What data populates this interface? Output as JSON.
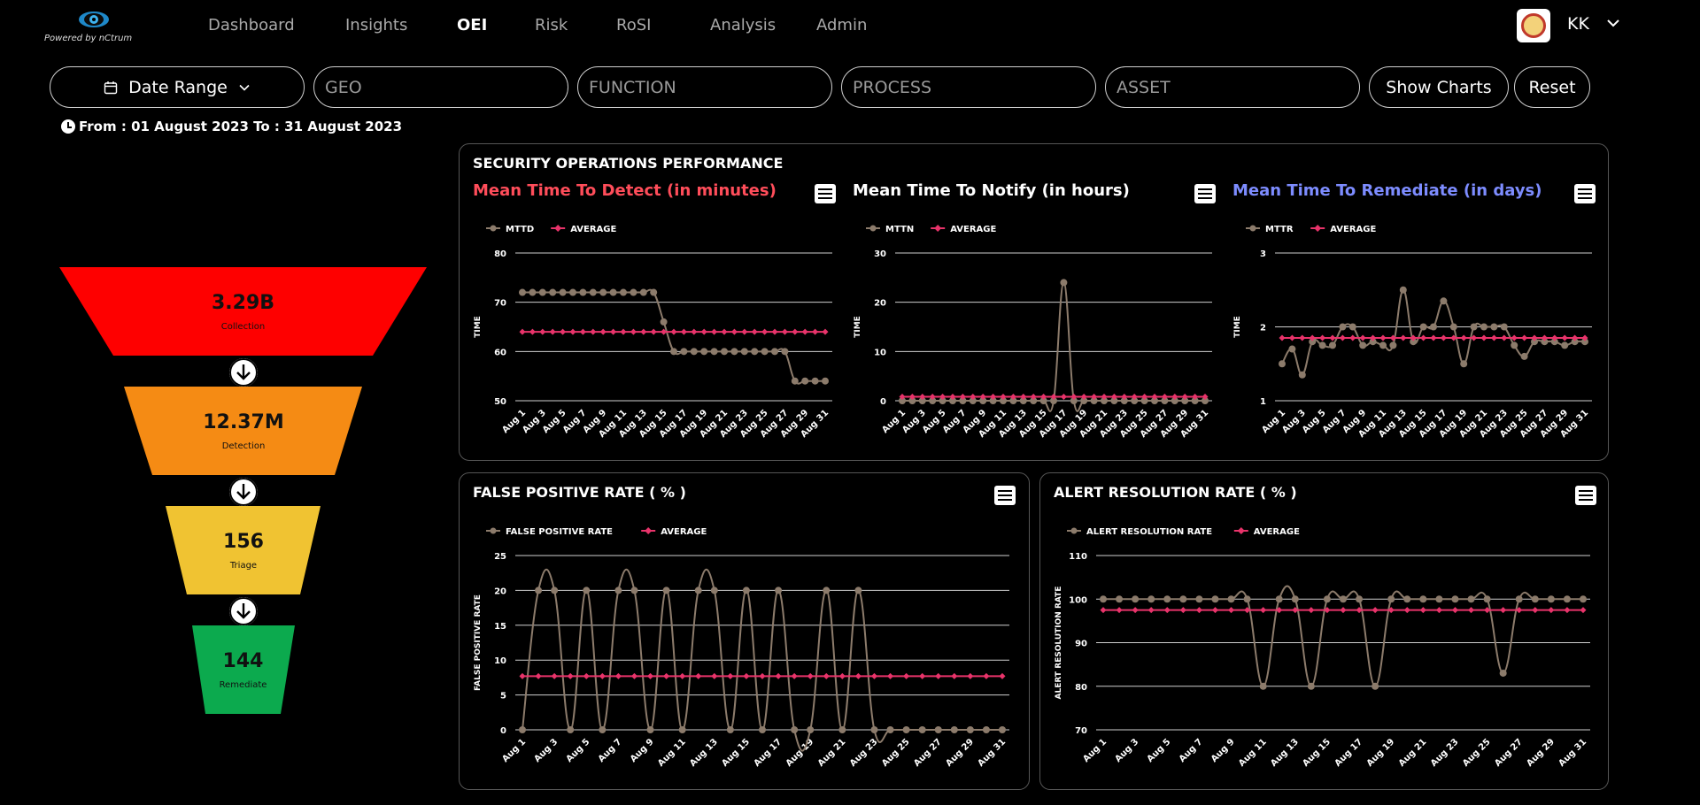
{
  "brand": {
    "powered_by": "Powered by nCtrum"
  },
  "nav": [
    "Dashboard",
    "Insights",
    "OEI",
    "Risk",
    "RoSI",
    "Analysis",
    "Admin"
  ],
  "nav_active": "OEI",
  "user": {
    "initials": "KK"
  },
  "filters": {
    "date_range": "Date Range",
    "geo": "GEO",
    "function": "FUNCTION",
    "process": "PROCESS",
    "asset": "ASSET",
    "show_charts": "Show Charts",
    "reset": "Reset"
  },
  "date_note": "From : 01 August 2023 To : 31 August 2023",
  "funnel": [
    {
      "value": "3.29B",
      "label": "Collection",
      "color": "#fe0000"
    },
    {
      "value": "12.37M",
      "label": "Detection",
      "color": "#f58b14"
    },
    {
      "value": "156",
      "label": "Triage",
      "color": "#f0c332"
    },
    {
      "value": "144",
      "label": "Remediate",
      "color": "#0caa4e"
    }
  ],
  "panels": {
    "sop_title": "SECURITY OPERATIONS PERFORMANCE",
    "fpr_title": "FALSE POSITIVE RATE ( % )",
    "arr_title": "ALERT RESOLUTION RATE ( % )"
  },
  "colors": {
    "series": "#8c7b6b",
    "average": "#e8336a",
    "mttd_title": "#ff4d5a",
    "mttr_title": "#7d8cff"
  },
  "chart_data": [
    {
      "id": "mttd",
      "type": "line",
      "title": "Mean Time To Detect (in minutes)",
      "ylabel": "TIME",
      "ylim": [
        50,
        80
      ],
      "yticks": [
        50,
        60,
        70,
        80
      ],
      "x": [
        "Aug 1",
        "Aug 2",
        "Aug 3",
        "Aug 4",
        "Aug 5",
        "Aug 6",
        "Aug 7",
        "Aug 8",
        "Aug 9",
        "Aug 10",
        "Aug 11",
        "Aug 12",
        "Aug 13",
        "Aug 14",
        "Aug 15",
        "Aug 16",
        "Aug 17",
        "Aug 18",
        "Aug 19",
        "Aug 20",
        "Aug 21",
        "Aug 22",
        "Aug 23",
        "Aug 24",
        "Aug 25",
        "Aug 26",
        "Aug 27",
        "Aug 28",
        "Aug 29",
        "Aug 30",
        "Aug 31"
      ],
      "series": [
        {
          "name": "MTTD",
          "values": [
            72,
            72,
            72,
            72,
            72,
            72,
            72,
            72,
            72,
            72,
            72,
            72,
            72,
            72,
            66,
            60,
            60,
            60,
            60,
            60,
            60,
            60,
            60,
            60,
            60,
            60,
            60,
            54,
            54,
            54,
            54
          ]
        },
        {
          "name": "AVERAGE",
          "values": [
            64,
            64,
            64,
            64,
            64,
            64,
            64,
            64,
            64,
            64,
            64,
            64,
            64,
            64,
            64,
            64,
            64,
            64,
            64,
            64,
            64,
            64,
            64,
            64,
            64,
            64,
            64,
            64,
            64,
            64,
            64
          ]
        }
      ]
    },
    {
      "id": "mttn",
      "type": "line",
      "title": "Mean Time To Notify (in hours)",
      "ylabel": "TIME",
      "ylim": [
        0,
        30
      ],
      "yticks": [
        0,
        10,
        20,
        30
      ],
      "x": [
        "Aug 1",
        "Aug 2",
        "Aug 3",
        "Aug 4",
        "Aug 5",
        "Aug 6",
        "Aug 7",
        "Aug 8",
        "Aug 9",
        "Aug 10",
        "Aug 11",
        "Aug 12",
        "Aug 13",
        "Aug 14",
        "Aug 15",
        "Aug 16",
        "Aug 17",
        "Aug 18",
        "Aug 19",
        "Aug 20",
        "Aug 21",
        "Aug 22",
        "Aug 23",
        "Aug 24",
        "Aug 25",
        "Aug 26",
        "Aug 27",
        "Aug 28",
        "Aug 29",
        "Aug 30",
        "Aug 31"
      ],
      "series": [
        {
          "name": "MTTN",
          "values": [
            0,
            0,
            0,
            0,
            0,
            0,
            0,
            0,
            0,
            0,
            0,
            0,
            0,
            0,
            0,
            0,
            24,
            0,
            0,
            0,
            0,
            0,
            0,
            0,
            0,
            0,
            0,
            0,
            0,
            0,
            0
          ]
        },
        {
          "name": "AVERAGE",
          "values": [
            0.8,
            0.8,
            0.8,
            0.8,
            0.8,
            0.8,
            0.8,
            0.8,
            0.8,
            0.8,
            0.8,
            0.8,
            0.8,
            0.8,
            0.8,
            0.8,
            0.8,
            0.8,
            0.8,
            0.8,
            0.8,
            0.8,
            0.8,
            0.8,
            0.8,
            0.8,
            0.8,
            0.8,
            0.8,
            0.8,
            0.8
          ]
        }
      ]
    },
    {
      "id": "mttr",
      "type": "line",
      "title": "Mean Time To Remediate (in days)",
      "ylabel": "TIME",
      "ylim": [
        1,
        3
      ],
      "yticks": [
        1,
        2,
        3
      ],
      "x": [
        "Aug 1",
        "Aug 2",
        "Aug 3",
        "Aug 4",
        "Aug 5",
        "Aug 6",
        "Aug 7",
        "Aug 8",
        "Aug 9",
        "Aug 10",
        "Aug 11",
        "Aug 12",
        "Aug 13",
        "Aug 14",
        "Aug 15",
        "Aug 16",
        "Aug 17",
        "Aug 18",
        "Aug 19",
        "Aug 20",
        "Aug 21",
        "Aug 22",
        "Aug 23",
        "Aug 24",
        "Aug 25",
        "Aug 26",
        "Aug 27",
        "Aug 28",
        "Aug 29",
        "Aug 30",
        "Aug 31"
      ],
      "series": [
        {
          "name": "MTTR",
          "values": [
            1.5,
            1.7,
            1.35,
            1.8,
            1.75,
            1.75,
            2.0,
            2.0,
            1.75,
            1.8,
            1.75,
            1.75,
            2.5,
            1.8,
            2.0,
            2.0,
            2.35,
            2.0,
            1.5,
            2.0,
            2.0,
            2.0,
            2.0,
            1.75,
            1.6,
            1.8,
            1.8,
            1.8,
            1.75,
            1.8,
            1.8
          ]
        },
        {
          "name": "AVERAGE",
          "values": [
            1.85,
            1.85,
            1.85,
            1.85,
            1.85,
            1.85,
            1.85,
            1.85,
            1.85,
            1.85,
            1.85,
            1.85,
            1.85,
            1.85,
            1.85,
            1.85,
            1.85,
            1.85,
            1.85,
            1.85,
            1.85,
            1.85,
            1.85,
            1.85,
            1.85,
            1.85,
            1.85,
            1.85,
            1.85,
            1.85,
            1.85
          ]
        }
      ]
    },
    {
      "id": "fpr",
      "type": "line",
      "ylabel": "FALSE POSITIVE RATE",
      "ylim": [
        0,
        25
      ],
      "yticks": [
        0,
        5,
        10,
        15,
        20,
        25
      ],
      "x": [
        "Aug 1",
        "Aug 2",
        "Aug 3",
        "Aug 4",
        "Aug 5",
        "Aug 6",
        "Aug 7",
        "Aug 8",
        "Aug 9",
        "Aug 10",
        "Aug 11",
        "Aug 12",
        "Aug 13",
        "Aug 14",
        "Aug 15",
        "Aug 16",
        "Aug 17",
        "Aug 18",
        "Aug 19",
        "Aug 20",
        "Aug 21",
        "Aug 22",
        "Aug 23",
        "Aug 24",
        "Aug 25",
        "Aug 26",
        "Aug 27",
        "Aug 28",
        "Aug 29",
        "Aug 30",
        "Aug 31"
      ],
      "series": [
        {
          "name": "FALSE POSITIVE RATE",
          "values": [
            0,
            20,
            20,
            0,
            20,
            0,
            20,
            20,
            0,
            20,
            0,
            20,
            20,
            0,
            20,
            0,
            20,
            0,
            0,
            20,
            0,
            20,
            0,
            0,
            0,
            0,
            0,
            0,
            0,
            0,
            0
          ]
        },
        {
          "name": "AVERAGE",
          "values": [
            7.7,
            7.7,
            7.7,
            7.7,
            7.7,
            7.7,
            7.7,
            7.7,
            7.7,
            7.7,
            7.7,
            7.7,
            7.7,
            7.7,
            7.7,
            7.7,
            7.7,
            7.7,
            7.7,
            7.7,
            7.7,
            7.7,
            7.7,
            7.7,
            7.7,
            7.7,
            7.7,
            7.7,
            7.7,
            7.7,
            7.7
          ]
        }
      ]
    },
    {
      "id": "arr",
      "type": "line",
      "ylabel": "ALERT RESOLUTION RATE",
      "ylim": [
        70,
        110
      ],
      "yticks": [
        70,
        80,
        90,
        100,
        110
      ],
      "x": [
        "Aug 1",
        "Aug 2",
        "Aug 3",
        "Aug 4",
        "Aug 5",
        "Aug 6",
        "Aug 7",
        "Aug 8",
        "Aug 9",
        "Aug 10",
        "Aug 11",
        "Aug 12",
        "Aug 13",
        "Aug 14",
        "Aug 15",
        "Aug 16",
        "Aug 17",
        "Aug 18",
        "Aug 19",
        "Aug 20",
        "Aug 21",
        "Aug 22",
        "Aug 23",
        "Aug 24",
        "Aug 25",
        "Aug 26",
        "Aug 27",
        "Aug 28",
        "Aug 29",
        "Aug 30",
        "Aug 31"
      ],
      "series": [
        {
          "name": "ALERT RESOLUTION RATE",
          "values": [
            100,
            100,
            100,
            100,
            100,
            100,
            100,
            100,
            100,
            100,
            80,
            100,
            100,
            80,
            100,
            100,
            100,
            80,
            100,
            100,
            100,
            100,
            100,
            100,
            100,
            83,
            100,
            100,
            100,
            100,
            100
          ]
        },
        {
          "name": "AVERAGE",
          "values": [
            97.5,
            97.5,
            97.5,
            97.5,
            97.5,
            97.5,
            97.5,
            97.5,
            97.5,
            97.5,
            97.5,
            97.5,
            97.5,
            97.5,
            97.5,
            97.5,
            97.5,
            97.5,
            97.5,
            97.5,
            97.5,
            97.5,
            97.5,
            97.5,
            97.5,
            97.5,
            97.5,
            97.5,
            97.5,
            97.5,
            97.5
          ]
        }
      ]
    }
  ]
}
